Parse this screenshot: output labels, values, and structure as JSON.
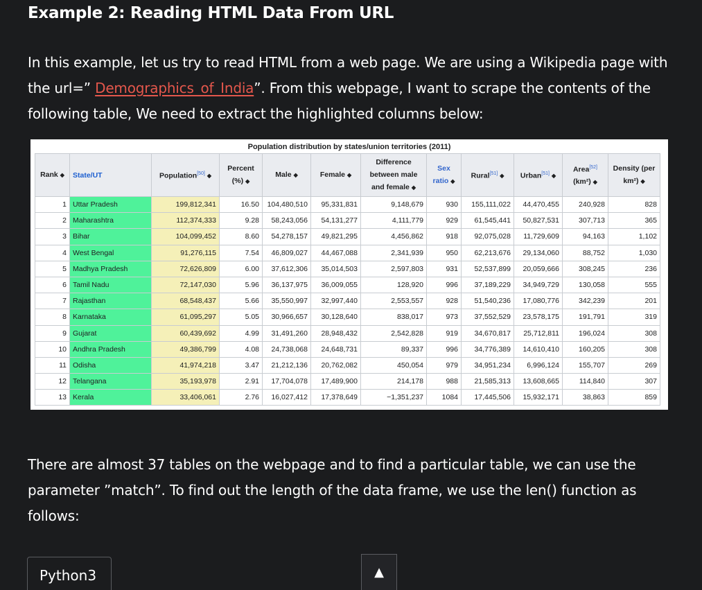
{
  "heading": "Example 2: Reading HTML Data From URL",
  "para1": {
    "before": "In this example, let us try to read HTML from a web page. We are using a Wikipedia page with the url=” ",
    "link": "Demographics_of_India",
    "after": "”. From this webpage, I want to scrape the contents of the following table, We need to extract the highlighted columns below:"
  },
  "table": {
    "caption": "Population distribution by states/union territories (2011)",
    "headers": {
      "rank": "Rank",
      "state": "State/UT",
      "population": "Population",
      "population_ref": "[50]",
      "percent": "Percent (%)",
      "male": "Male",
      "female": "Female",
      "difference": "Difference between male and female",
      "sex_ratio": "Sex ratio",
      "rural": "Rural",
      "rural_ref": "[51]",
      "urban": "Urban",
      "urban_ref": "[51]",
      "area": "Area",
      "area_ref": "[52]",
      "area_unit": "(km²)",
      "density": "Density (per km²)"
    },
    "rows": [
      [
        "1",
        "Uttar Pradesh",
        "199,812,341",
        "16.50",
        "104,480,510",
        "95,331,831",
        "9,148,679",
        "930",
        "155,111,022",
        "44,470,455",
        "240,928",
        "828"
      ],
      [
        "2",
        "Maharashtra",
        "112,374,333",
        "9.28",
        "58,243,056",
        "54,131,277",
        "4,111,779",
        "929",
        "61,545,441",
        "50,827,531",
        "307,713",
        "365"
      ],
      [
        "3",
        "Bihar",
        "104,099,452",
        "8.60",
        "54,278,157",
        "49,821,295",
        "4,456,862",
        "918",
        "92,075,028",
        "11,729,609",
        "94,163",
        "1,102"
      ],
      [
        "4",
        "West Bengal",
        "91,276,115",
        "7.54",
        "46,809,027",
        "44,467,088",
        "2,341,939",
        "950",
        "62,213,676",
        "29,134,060",
        "88,752",
        "1,030"
      ],
      [
        "5",
        "Madhya Pradesh",
        "72,626,809",
        "6.00",
        "37,612,306",
        "35,014,503",
        "2,597,803",
        "931",
        "52,537,899",
        "20,059,666",
        "308,245",
        "236"
      ],
      [
        "6",
        "Tamil Nadu",
        "72,147,030",
        "5.96",
        "36,137,975",
        "36,009,055",
        "128,920",
        "996",
        "37,189,229",
        "34,949,729",
        "130,058",
        "555"
      ],
      [
        "7",
        "Rajasthan",
        "68,548,437",
        "5.66",
        "35,550,997",
        "32,997,440",
        "2,553,557",
        "928",
        "51,540,236",
        "17,080,776",
        "342,239",
        "201"
      ],
      [
        "8",
        "Karnataka",
        "61,095,297",
        "5.05",
        "30,966,657",
        "30,128,640",
        "838,017",
        "973",
        "37,552,529",
        "23,578,175",
        "191,791",
        "319"
      ],
      [
        "9",
        "Gujarat",
        "60,439,692",
        "4.99",
        "31,491,260",
        "28,948,432",
        "2,542,828",
        "919",
        "34,670,817",
        "25,712,811",
        "196,024",
        "308"
      ],
      [
        "10",
        "Andhra Pradesh",
        "49,386,799",
        "4.08",
        "24,738,068",
        "24,648,731",
        "89,337",
        "996",
        "34,776,389",
        "14,610,410",
        "160,205",
        "308"
      ],
      [
        "11",
        "Odisha",
        "41,974,218",
        "3.47",
        "21,212,136",
        "20,762,082",
        "450,054",
        "979",
        "34,951,234",
        "6,996,124",
        "155,707",
        "269"
      ],
      [
        "12",
        "Telangana",
        "35,193,978",
        "2.91",
        "17,704,078",
        "17,489,900",
        "214,178",
        "988",
        "21,585,313",
        "13,608,665",
        "114,840",
        "307"
      ],
      [
        "13",
        "Kerala",
        "33,406,061",
        "2.76",
        "16,027,412",
        "17,378,649",
        "−1,351,237",
        "1084",
        "17,445,506",
        "15,932,171",
        "38,863",
        "859"
      ]
    ]
  },
  "para2": "There are almost 37 tables on the webpage and to find a particular table, we can use the parameter ”match”. To find out the length of the data frame, we use the len() function as follows:",
  "code_tab_label": "Python3",
  "scroll_top_icon": "▲",
  "colors": {
    "state_highlight": "#4ff29a",
    "population_highlight": "#f5f0b8",
    "link": "#e4574c",
    "background": "#1b1c1e"
  }
}
